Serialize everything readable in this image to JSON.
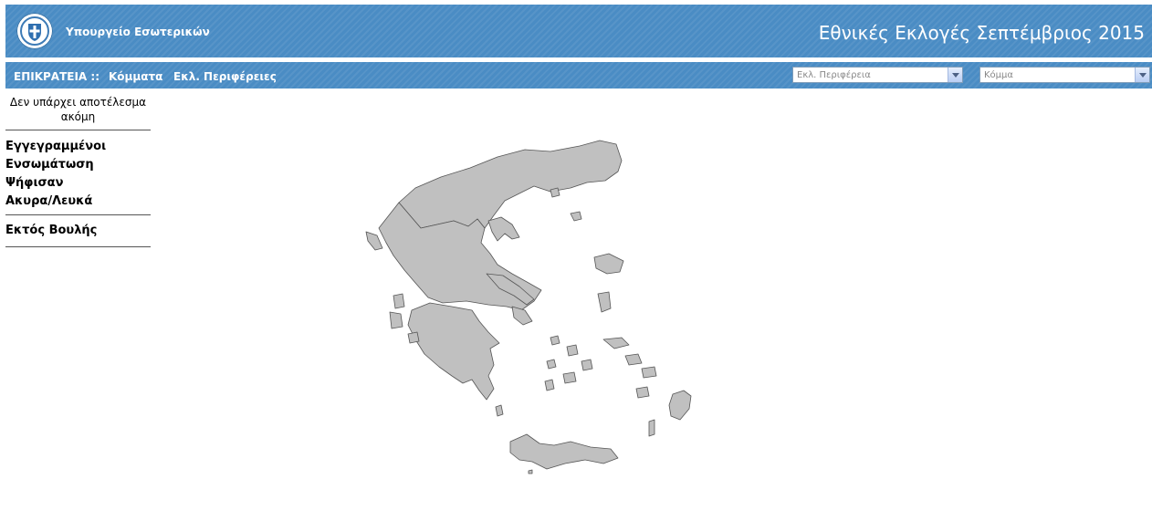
{
  "header": {
    "ministry": "Υπουργείο Εσωτερικών",
    "title": "Εθνικές Εκλογές Σεπτέμβριος 2015",
    "logo_icon": "greek-coat-of-arms-icon"
  },
  "nav": {
    "links": [
      "ΕΠΙΚΡΑΤΕΙΑ ::",
      "Κόμματα",
      "Εκλ. Περιφέρειες"
    ],
    "region_select": {
      "value": "Εκλ. Περιφέρεια"
    },
    "party_select": {
      "value": "Κόμμα"
    }
  },
  "sidebar": {
    "no_result": "Δεν υπάρχει αποτέλεσμα ακόμη",
    "stats": [
      "Εγγεγραμμένοι",
      "Ενσωμάτωση",
      "Ψήφισαν",
      "Ακυρα/Λευκά"
    ],
    "extra": "Εκτός Βουλής"
  },
  "map": {
    "icon": "greece-map-icon"
  },
  "colors": {
    "brand_blue": "#4a8cc4",
    "map_fill": "#c0c0c0",
    "map_stroke": "#555555"
  }
}
